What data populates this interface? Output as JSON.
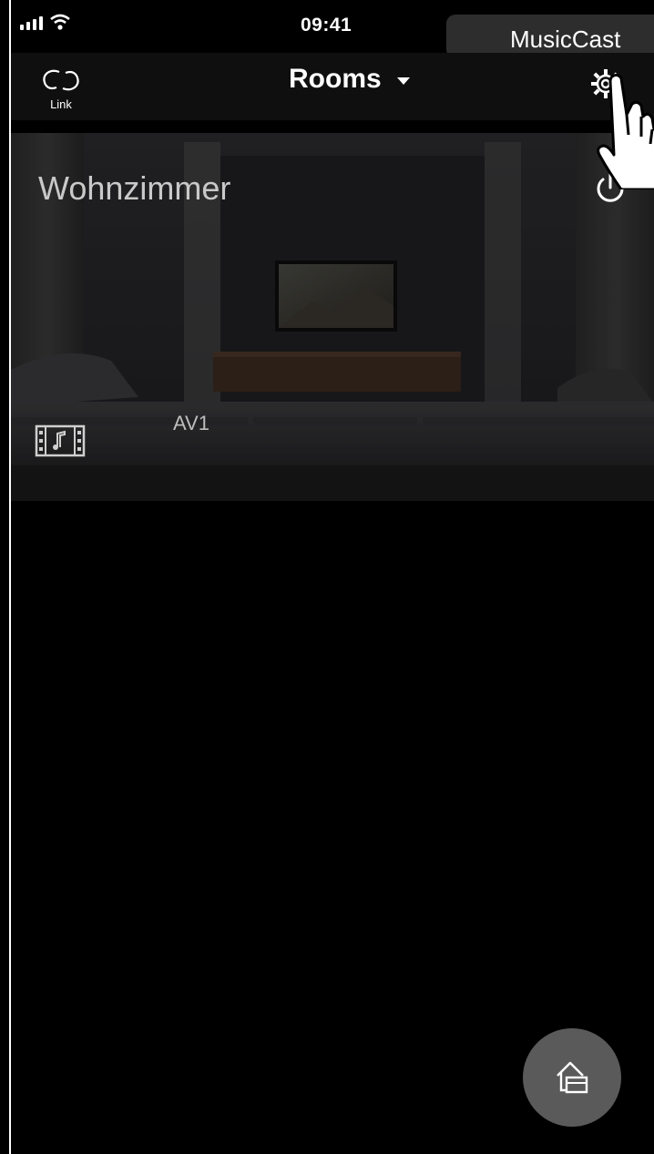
{
  "status_bar": {
    "time": "09:41",
    "app_name": "MusicCast"
  },
  "nav": {
    "link_label": "Link",
    "title": "Rooms",
    "settings_icon": "gear-icon"
  },
  "room": {
    "name": "Wohnzimmer",
    "source_label": "AV1",
    "source_icon": "film-music-icon",
    "power_icon": "power-icon"
  },
  "fab": {
    "icon": "add-room-icon"
  },
  "colors": {
    "background": "#000000",
    "nav_bar": "#0f0f0f",
    "fab": "#5a5a5a",
    "room_text": "#c9c9c9"
  }
}
